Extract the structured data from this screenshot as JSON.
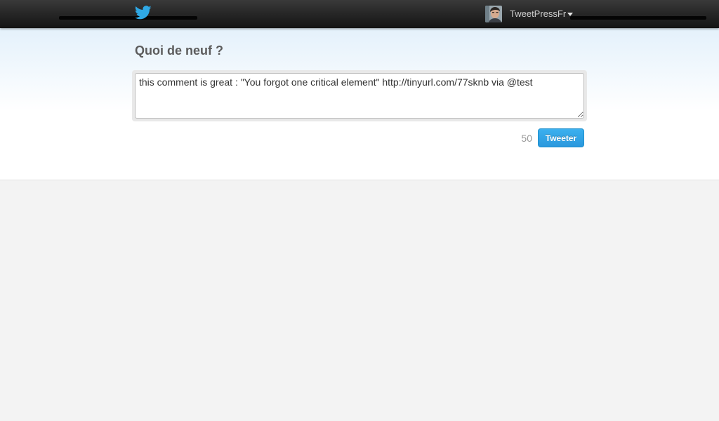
{
  "header": {
    "logo_icon": "twitter-bird-icon",
    "account": {
      "screen_name": "TweetPressFr",
      "avatar_icon": "user-avatar",
      "dropdown_icon": "caret-down-icon"
    }
  },
  "compose": {
    "heading": "Quoi de neuf ?",
    "tweet_text": "this comment is great : \"You forgot one critical element\" http://tinyurl.com/77sknb via @test",
    "char_count": "50",
    "submit_label": "Tweeter"
  },
  "colors": {
    "accent": "#2a9ddf",
    "topbar": "#262626",
    "heading": "#5c5c5c",
    "page_background": "#f3f3f3"
  }
}
